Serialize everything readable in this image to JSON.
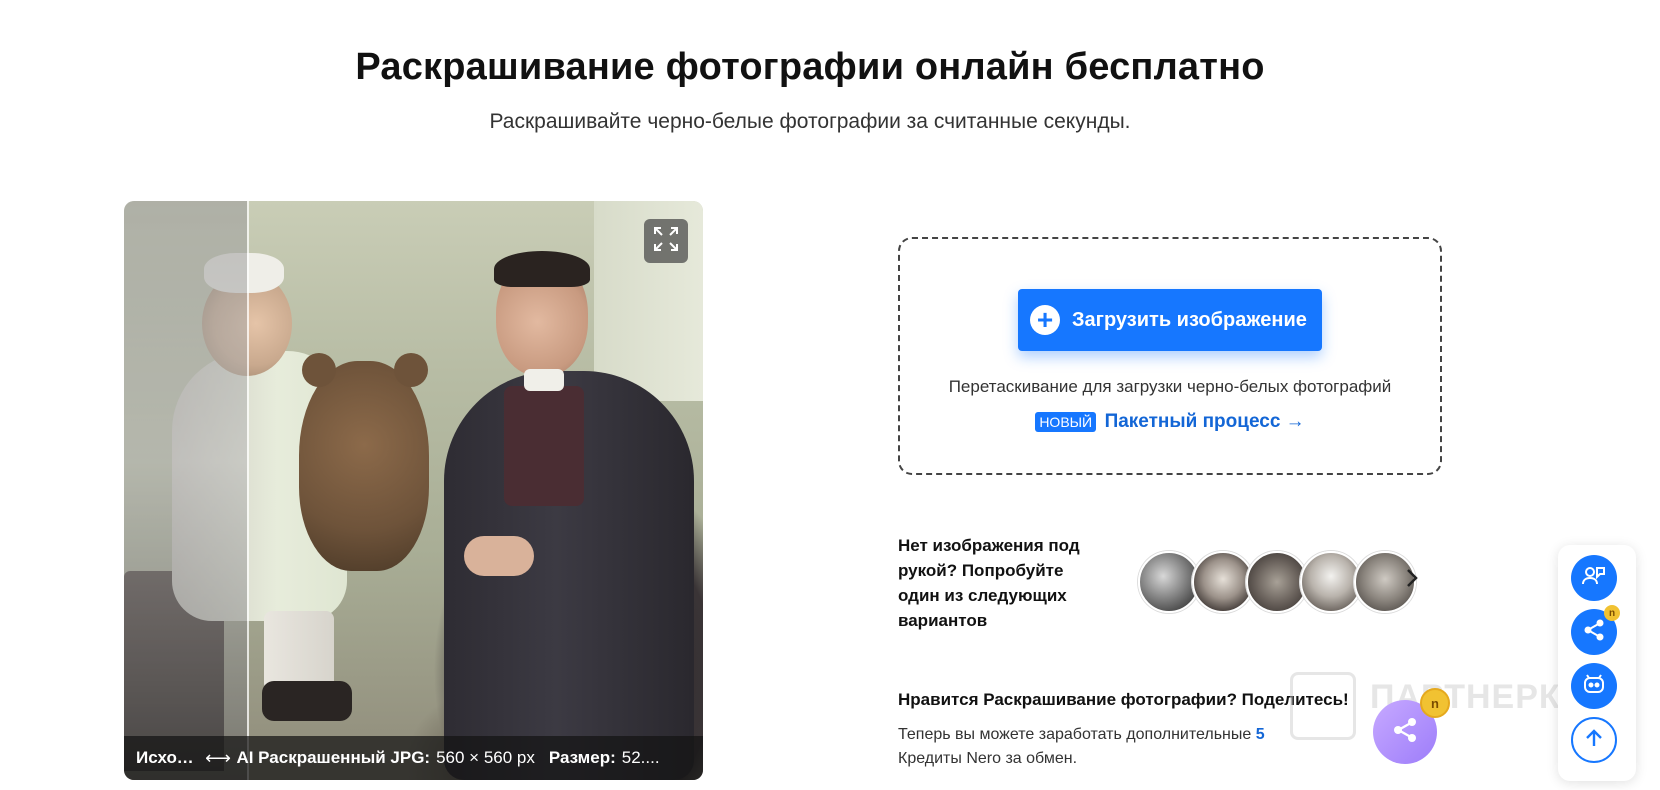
{
  "header": {
    "title": "Раскрашивание фотографии онлайн бесплатно",
    "subtitle": "Раскрашивайте черно-белые фотографии за считанные секунды."
  },
  "preview": {
    "caption_original": "Исходн...",
    "caption_arrow": "⟷",
    "caption_result_label": "AI Раскрашенный JPG:",
    "caption_dims": "560 × 560 px",
    "caption_size_label": "Размер:",
    "caption_size_value": "52...."
  },
  "upload": {
    "button_label": "Загрузить изображение",
    "drag_text": "Перетаскивание для загрузки черно-белых фотографий",
    "new_badge": "НОВЫЙ",
    "batch_link": "Пакетный процесс →"
  },
  "samples": {
    "prompt": "Нет изображения под рукой? Попробуйте один из следующих вариантов",
    "next_icon": "chevron-right-icon"
  },
  "share": {
    "title": "Нравится Раскрашивание фотографии? Поделитесь!",
    "text_before": "Теперь вы можете заработать дополнительные",
    "credits": "5",
    "text_after": "Кредиты Nero за обмен.",
    "coin_label": "n"
  },
  "watermark": "ПАРТНЕРКИ",
  "floating_toolbar": {
    "items": [
      "support-icon",
      "share-icon",
      "robot-icon",
      "arrow-up-icon"
    ],
    "coin_label": "n"
  },
  "colors": {
    "accent": "#1677ff",
    "link": "#1366d6",
    "share_gradient": "#b493fc"
  }
}
